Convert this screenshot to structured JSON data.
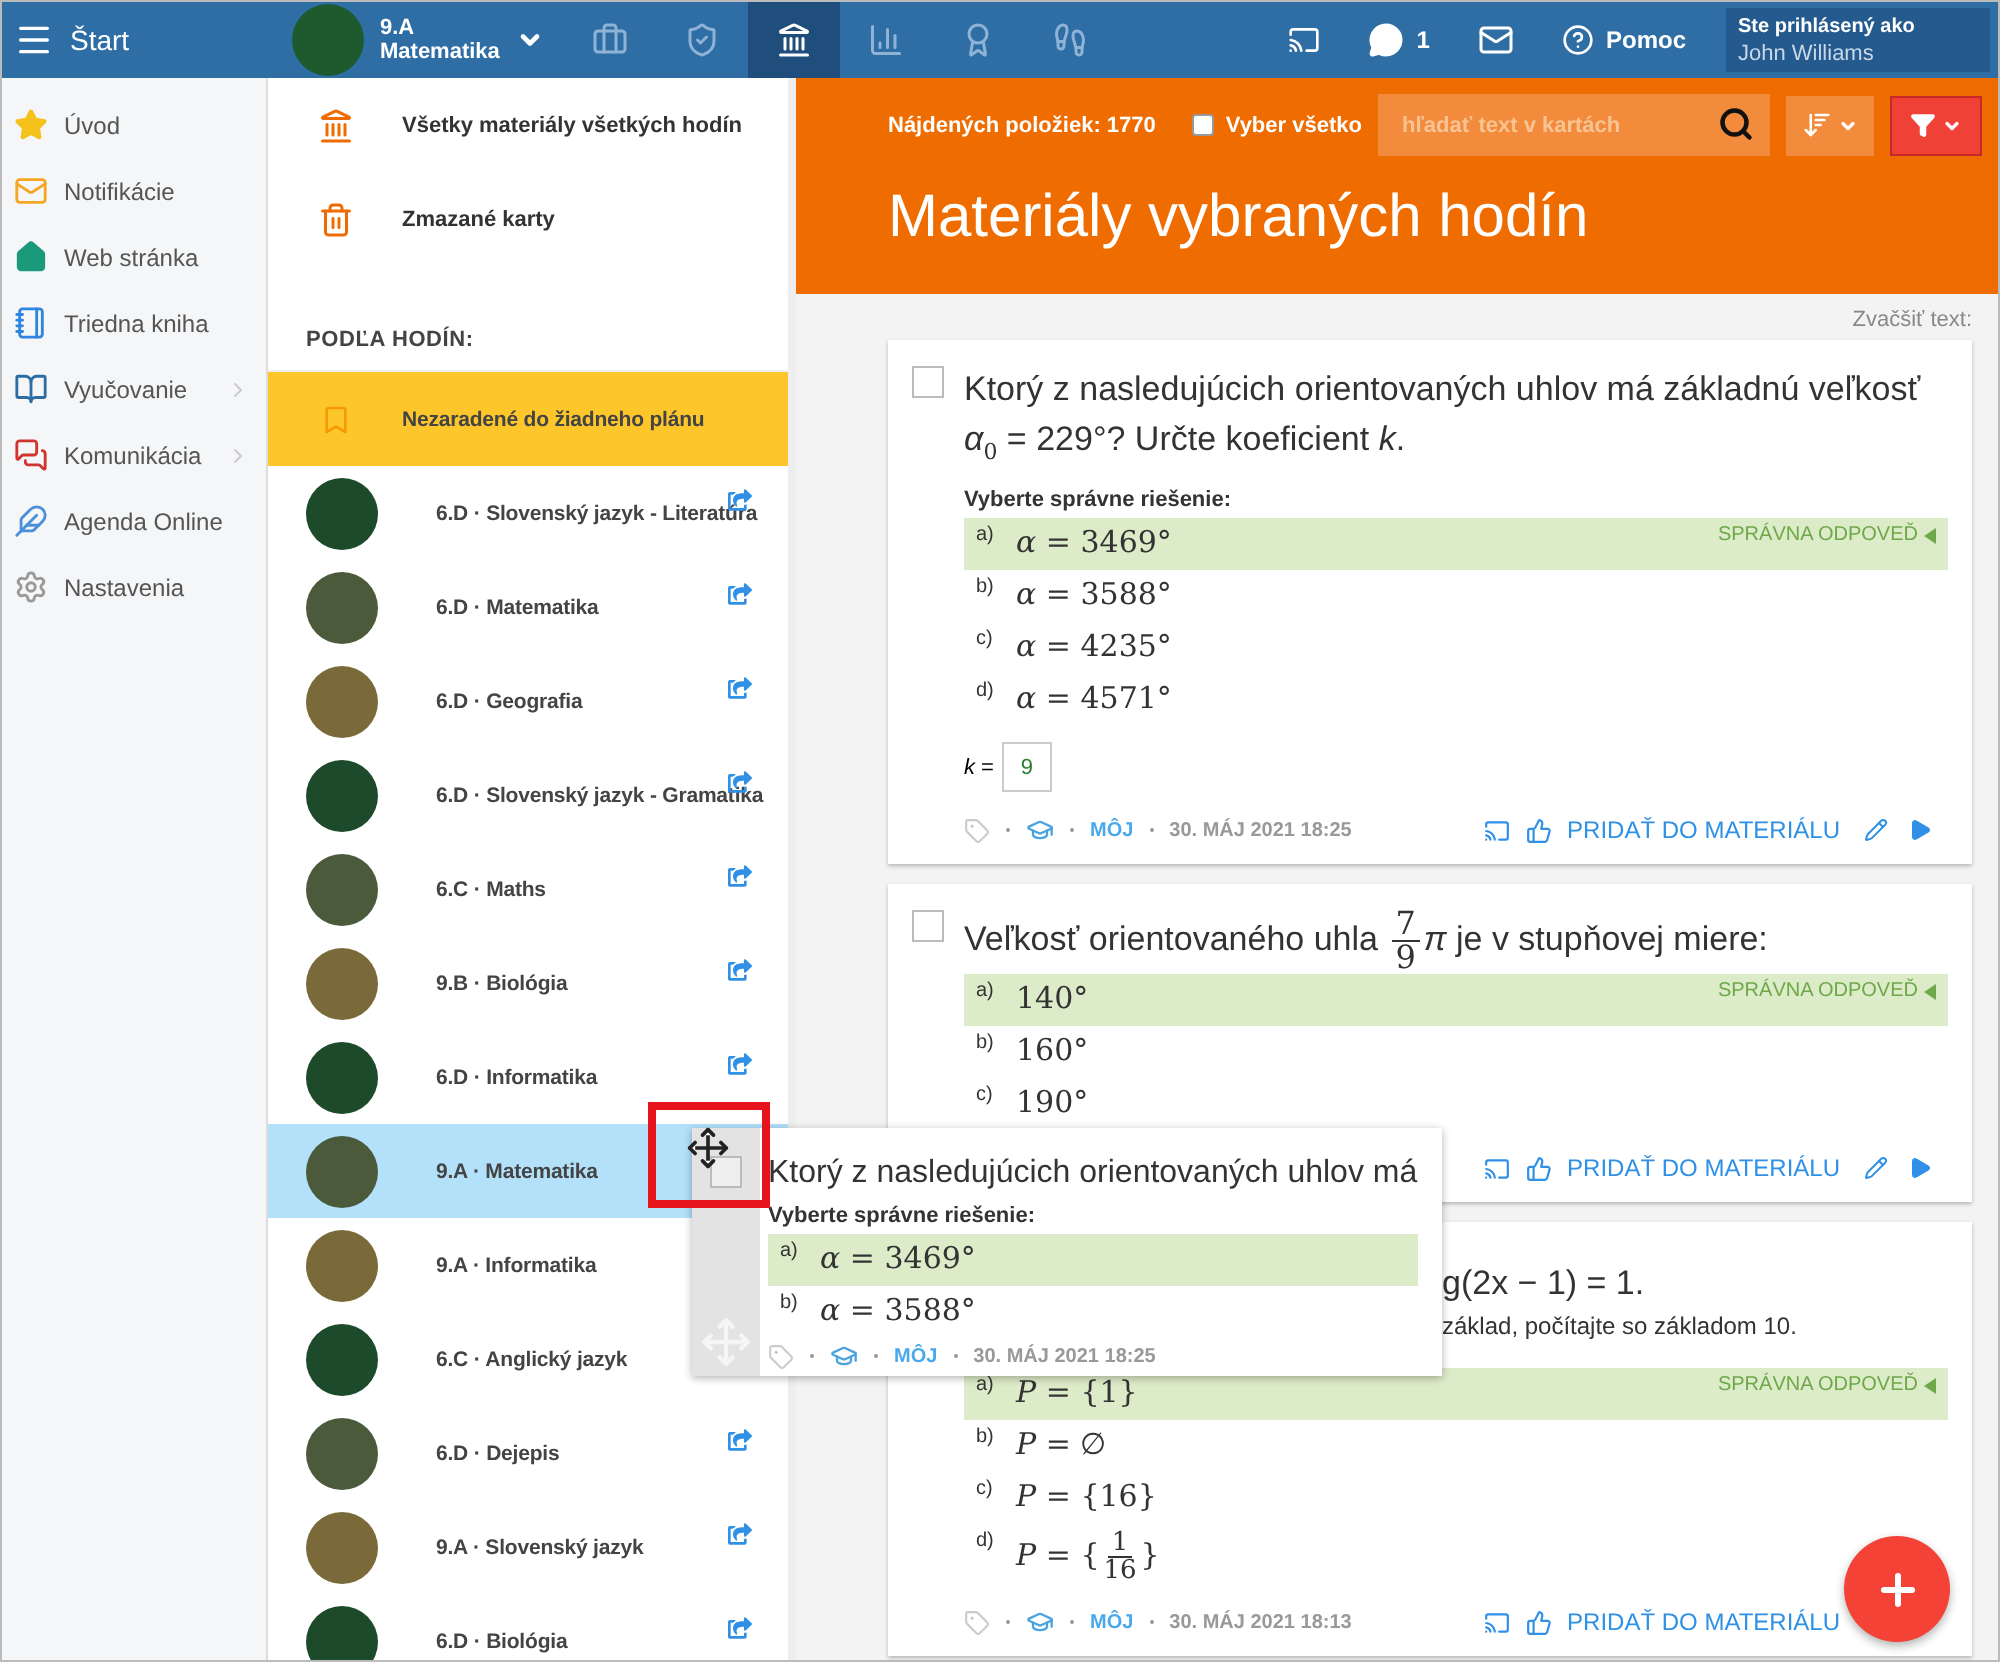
{
  "top_bar": {
    "menu_label": "Štart",
    "class_selector": {
      "line1": "9.A",
      "line2": "Matematika"
    },
    "modules": [
      {
        "kind": "briefcase",
        "selected": false
      },
      {
        "kind": "shield",
        "selected": false
      },
      {
        "kind": "bank",
        "selected": true
      },
      {
        "kind": "chart",
        "selected": false
      },
      {
        "kind": "grade",
        "selected": false
      },
      {
        "kind": "walk",
        "selected": false
      }
    ],
    "messages_count": "1",
    "help_label": "Pomoc",
    "user": {
      "caption": "Ste prihlásený ako",
      "name": "John Williams"
    }
  },
  "nav": [
    {
      "kind": "star",
      "label": "Úvod",
      "has_submenu": false
    },
    {
      "kind": "mail",
      "label": "Notifikácie",
      "has_submenu": false
    },
    {
      "kind": "home",
      "label": "Web stránka",
      "has_submenu": false
    },
    {
      "kind": "notebook",
      "label": "Triedna kniha",
      "has_submenu": false
    },
    {
      "kind": "book",
      "label": "Vyučovanie",
      "has_submenu": true
    },
    {
      "kind": "chat",
      "label": "Komunikácia",
      "has_submenu": true
    },
    {
      "kind": "pen",
      "label": "Agenda Online",
      "has_submenu": false
    },
    {
      "kind": "gear",
      "label": "Nastavenia",
      "has_submenu": false
    }
  ],
  "materials_menu": {
    "links": [
      {
        "kind": "bank",
        "label": "Všetky materiály všetkých hodín"
      },
      {
        "kind": "trash",
        "label": "Zmazané karty"
      }
    ],
    "section_title": "PODĽA HODÍN:",
    "lessons": [
      {
        "kind": "unassigned",
        "label": "Nezaradené do žiadneho plánu",
        "selected": false,
        "shared": false
      },
      {
        "kind": "lesson",
        "label": "6.D · Slovenský jazyk - Literatúra",
        "selected": false,
        "shared": true
      },
      {
        "kind": "lesson",
        "label": "6.D · Matematika",
        "selected": false,
        "shared": true
      },
      {
        "kind": "lesson",
        "label": "6.D · Geografia",
        "selected": false,
        "shared": true
      },
      {
        "kind": "lesson",
        "label": "6.D · Slovenský jazyk - Gramatika",
        "selected": false,
        "shared": true
      },
      {
        "kind": "lesson",
        "label": "6.C · Maths",
        "selected": false,
        "shared": true
      },
      {
        "kind": "lesson",
        "label": "9.B · Biológia",
        "selected": false,
        "shared": true
      },
      {
        "kind": "lesson",
        "label": "6.D · Informatika",
        "selected": false,
        "shared": true
      },
      {
        "kind": "lesson",
        "label": "9.A · Matematika",
        "selected": true,
        "shared": false
      },
      {
        "kind": "lesson",
        "label": "9.A · Informatika",
        "selected": false,
        "shared": false
      },
      {
        "kind": "lesson",
        "label": "6.C · Anglický jazyk",
        "selected": false,
        "shared": false
      },
      {
        "kind": "lesson",
        "label": "6.D · Dejepis",
        "selected": false,
        "shared": true
      },
      {
        "kind": "lesson",
        "label": "9.A · Slovenský jazyk",
        "selected": false,
        "shared": true
      },
      {
        "kind": "lesson",
        "label": "6.D · Biológia",
        "selected": false,
        "shared": true
      }
    ]
  },
  "header": {
    "count_label": "Nájdených položiek: 1770",
    "select_all": {
      "label": "Vyber všetko",
      "checked": false
    },
    "search_placeholder": "hľadať text v kartách",
    "title": "Materiály vybraných hodín"
  },
  "zoom_label": "Zvačšiť text:",
  "cards": [
    {
      "checked": false,
      "partly_covered": false,
      "question": [
        {
          "kind": "text",
          "text": "Ktorý z nasledujúcich orientovaných uhlov má základnú veľkosť *α*$_{0}$ = 229°? Určte koeficient *k*."
        }
      ],
      "prompt": "Vyberte správne riešenie:",
      "answers": [
        {
          "label": "a)",
          "parts": [
            {
              "kind": "text",
              "text": "*α* = 3469°"
            }
          ],
          "correct": true,
          "note": "SPRÁVNA ODPOVEĎ"
        },
        {
          "label": "b)",
          "parts": [
            {
              "kind": "text",
              "text": "*α* = 3588°"
            }
          ],
          "correct": false
        },
        {
          "label": "c)",
          "parts": [
            {
              "kind": "text",
              "text": "*α* = 4235°"
            }
          ],
          "correct": false
        },
        {
          "label": "d)",
          "parts": [
            {
              "kind": "text",
              "text": "*α* = 4571°"
            }
          ],
          "correct": false
        }
      ],
      "answer_field": {
        "label": "*k* =",
        "value": "9"
      },
      "footer": {
        "author": "MÔJ",
        "date": "30. MÁJ 2021 18:25",
        "add_label": "PRIDAŤ DO MATERIÁLU",
        "edit": true,
        "play": true
      }
    },
    {
      "checked": false,
      "partly_covered": false,
      "question": [
        {
          "kind": "text",
          "text": "Veľkosť orientovaného uhla "
        },
        {
          "kind": "fraction",
          "numerator": "7",
          "denominator": "9"
        },
        {
          "kind": "text",
          "text": "*π* je v stupňovej miere:"
        }
      ],
      "answers": [
        {
          "label": "a)",
          "parts": [
            {
              "kind": "text",
              "text": "140°"
            }
          ],
          "correct": true,
          "note": "SPRÁVNA ODPOVEĎ"
        },
        {
          "label": "b)",
          "parts": [
            {
              "kind": "text",
              "text": "160°"
            }
          ],
          "correct": false
        },
        {
          "label": "c)",
          "parts": [
            {
              "kind": "text",
              "text": "190°"
            }
          ],
          "correct": false
        }
      ],
      "footer": {
        "add_label": "PRIDAŤ DO MATERIÁLU",
        "edit": true,
        "play": true
      }
    },
    {
      "partly_covered": true,
      "question": [
        {
          "kind": "text",
          "text": "g(2x − 1) = 1."
        }
      ],
      "hint": "základ, počítajte so základom 10.",
      "answers": [
        {
          "label": "a)",
          "parts": [
            {
              "kind": "text",
              "text": "*P* = {1}"
            }
          ],
          "correct": true,
          "note": "SPRÁVNA ODPOVEĎ"
        },
        {
          "label": "b)",
          "parts": [
            {
              "kind": "text",
              "text": "*P* = ∅"
            }
          ],
          "correct": false
        },
        {
          "label": "c)",
          "parts": [
            {
              "kind": "text",
              "text": "*P* = {16}"
            }
          ],
          "correct": false
        },
        {
          "label": "d)",
          "parts": [
            {
              "kind": "text",
              "text": "*P* = {"
            },
            {
              "kind": "fraction",
              "numerator": "1",
              "denominator": "16"
            },
            {
              "kind": "text",
              "text": "}"
            }
          ],
          "correct": false
        }
      ],
      "footer": {
        "author": "MÔJ",
        "date": "30. MÁJ 2021 18:13",
        "add_label": "PRIDAŤ DO MATERIÁLU",
        "edit": false,
        "play": false
      }
    }
  ],
  "drag_preview": {
    "cursor_highlighted": true,
    "checked": false,
    "question": [
      {
        "kind": "text",
        "text": "Ktorý z nasledujúcich orientovaných uhlov má"
      }
    ],
    "prompt": "Vyberte správne riešenie:",
    "answers": [
      {
        "label": "a)",
        "parts": [
          {
            "kind": "text",
            "text": "*α* = 3469°"
          }
        ],
        "correct": true
      },
      {
        "label": "b)",
        "parts": [
          {
            "kind": "text",
            "text": "*α* = 3588°"
          }
        ],
        "correct": false
      }
    ],
    "footer": {
      "author": "MÔJ",
      "date": "30. MÁJ 2021 18:25"
    }
  }
}
